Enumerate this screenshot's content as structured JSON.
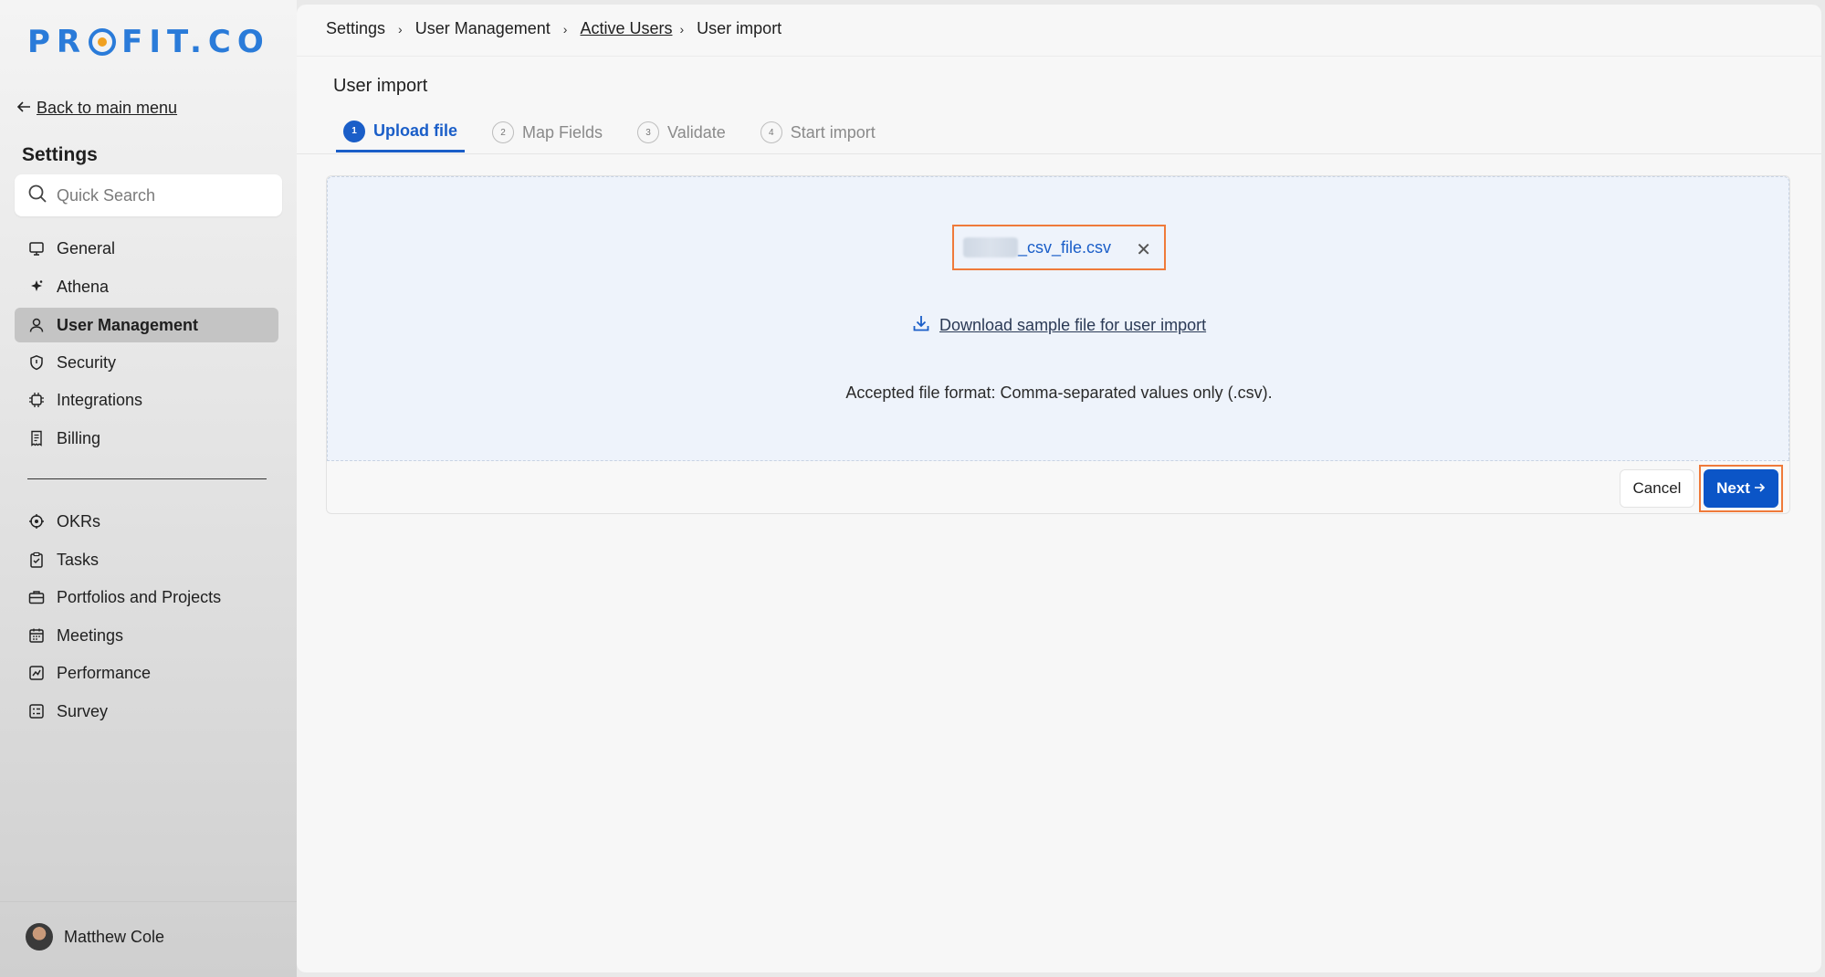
{
  "brand": {
    "logo_text_left": "PR",
    "logo_text_right": "FIT.CO",
    "accent": "#2a7bd9"
  },
  "sidebar": {
    "back_label": "Back to main menu",
    "title": "Settings",
    "search_placeholder": "Quick Search",
    "settings_items": [
      {
        "label": "General",
        "icon": "monitor-icon"
      },
      {
        "label": "Athena",
        "icon": "sparkle-icon"
      },
      {
        "label": "User Management",
        "icon": "user-icon",
        "active": true
      },
      {
        "label": "Security",
        "icon": "shield-icon"
      },
      {
        "label": "Integrations",
        "icon": "chip-icon"
      },
      {
        "label": "Billing",
        "icon": "receipt-icon"
      }
    ],
    "app_items": [
      {
        "label": "OKRs",
        "icon": "target-icon"
      },
      {
        "label": "Tasks",
        "icon": "clipboard-check-icon"
      },
      {
        "label": "Portfolios and Projects",
        "icon": "briefcase-icon"
      },
      {
        "label": "Meetings",
        "icon": "calendar-icon"
      },
      {
        "label": "Performance",
        "icon": "chart-line-icon"
      },
      {
        "label": "Survey",
        "icon": "checklist-icon"
      }
    ],
    "user_name": "Matthew Cole"
  },
  "breadcrumb": [
    "Settings",
    "User Management",
    "Active Users",
    "User import"
  ],
  "page_title": "User import",
  "steps": [
    {
      "num": "1",
      "label": "Upload file",
      "active": true
    },
    {
      "num": "2",
      "label": "Map Fields"
    },
    {
      "num": "3",
      "label": "Validate"
    },
    {
      "num": "4",
      "label": "Start import"
    }
  ],
  "upload": {
    "file_name_visible": "_csv_file.csv",
    "download_label": "Download sample file for user import",
    "format_text": "Accepted file format: Comma-separated values only (.csv)."
  },
  "actions": {
    "cancel": "Cancel",
    "next": "Next"
  },
  "colors": {
    "primary": "#0b55c7",
    "highlight": "#ef7a3a",
    "dropzone_bg": "#eef3fb"
  }
}
